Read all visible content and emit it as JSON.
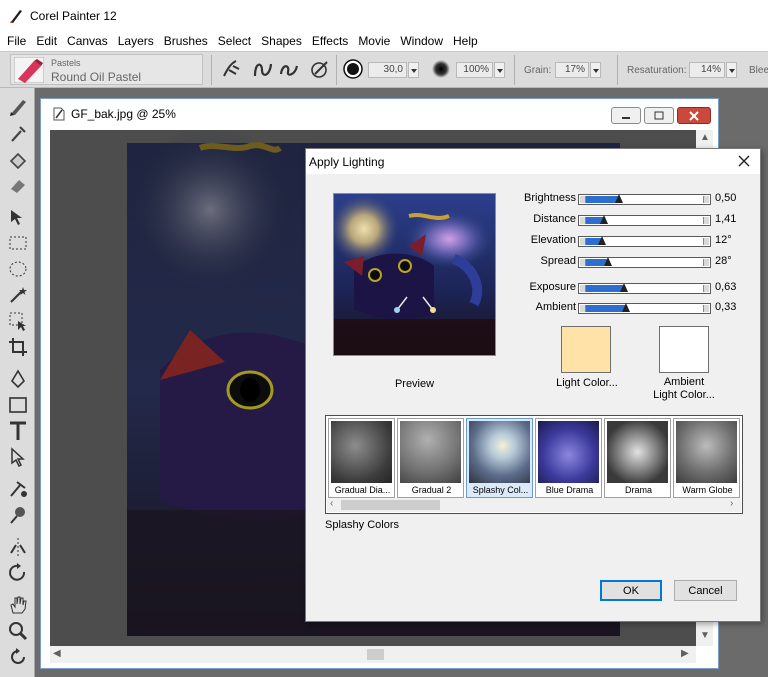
{
  "window": {
    "title": "Corel Painter 12"
  },
  "menu": [
    "File",
    "Edit",
    "Canvas",
    "Layers",
    "Brushes",
    "Select",
    "Shapes",
    "Effects",
    "Movie",
    "Window",
    "Help"
  ],
  "property_bar": {
    "brush_category": "Pastels",
    "brush_variant": "Round Oil Pastel",
    "size_value": "30,0",
    "opacity_value": "100%",
    "grain_label": "Grain:",
    "grain_value": "17%",
    "resaturation_label": "Resaturation:",
    "resaturation_value": "14%",
    "bleed_label": "Blee"
  },
  "document": {
    "title": "GF_bak.jpg @ 25%"
  },
  "dialog": {
    "title": "Apply Lighting",
    "preview_label": "Preview",
    "sliders": [
      {
        "label": "Brightness",
        "value": "0,50",
        "level": 0.28
      },
      {
        "label": "Distance",
        "value": "1,41",
        "level": 0.15
      },
      {
        "label": "Elevation",
        "value": "12°",
        "level": 0.13
      },
      {
        "label": "Spread",
        "value": "28°",
        "level": 0.18
      },
      {
        "label": "Exposure",
        "value": "0,63",
        "level": 0.32
      },
      {
        "label": "Ambient",
        "value": "0,33",
        "level": 0.34
      }
    ],
    "light_color_label": "Light Color...",
    "light_color": "#ffe2a8",
    "ambient_color_label": "Ambient\nLight Color...",
    "ambient_color": "#ffffff",
    "library": [
      {
        "name": "Gradual Dia..."
      },
      {
        "name": "Gradual 2"
      },
      {
        "name": "Splashy Col..."
      },
      {
        "name": "Blue Drama"
      },
      {
        "name": "Drama"
      },
      {
        "name": "Warm Globe"
      }
    ],
    "selected_name": "Splashy Colors",
    "ok_label": "OK",
    "cancel_label": "Cancel"
  }
}
